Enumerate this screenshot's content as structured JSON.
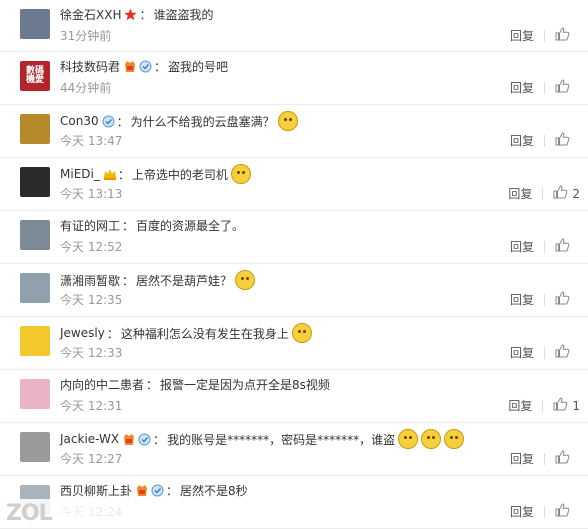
{
  "comments": [
    {
      "username": "徐金石XXH",
      "text": "谁盗盗我的",
      "time": "31分钟前",
      "reply": "回复",
      "likes": "",
      "avatar_color": "#6b7a8f",
      "badges": [
        "star"
      ],
      "emojis": 0,
      "row_h": 52
    },
    {
      "username": "科技数码君",
      "text": "盗我的号吧",
      "time": "44分钟前",
      "reply": "回复",
      "likes": "",
      "avatar_color": "#b3242b",
      "avatar_text": "數碼\n機愛",
      "badges": [
        "vip",
        "medal"
      ],
      "emojis": 0,
      "row_h": 53
    },
    {
      "username": "Con30",
      "text": "为什么不给我的云盘塞满？",
      "time": "今天 13:47",
      "reply": "回复",
      "likes": "",
      "avatar_color": "#b58a2a",
      "badges": [
        "medal"
      ],
      "emojis": 1,
      "row_h": 53
    },
    {
      "username": "MiEDi_",
      "text": "上帝选中的老司机",
      "time": "今天 13:13",
      "reply": "回复",
      "likes": "2",
      "avatar_color": "#2b2b2b",
      "badges": [
        "crown"
      ],
      "emojis": 1,
      "row_h": 53
    },
    {
      "username": "有证的网工",
      "text": "百度的资源最全了。",
      "time": "今天 12:52",
      "reply": "回复",
      "likes": "",
      "avatar_color": "#7c8a96",
      "badges": [],
      "emojis": 0,
      "row_h": 53
    },
    {
      "username": "潇湘雨暂歇",
      "text": "居然不是葫芦娃？",
      "time": "今天 12:35",
      "reply": "回复",
      "likes": "",
      "avatar_color": "#8fa0ae",
      "badges": [],
      "emojis": 1,
      "row_h": 53
    },
    {
      "username": "Jewesly",
      "text": "这种福利怎么没有发生在我身上",
      "time": "今天 12:33",
      "reply": "回复",
      "likes": "",
      "avatar_color": "#f2c82e",
      "badges": [],
      "emojis": 1,
      "row_h": 53
    },
    {
      "username": "内向的中二患者",
      "text": "报警一定是因为点开全是8s视频",
      "time": "今天 12:31",
      "reply": "回复",
      "likes": "1",
      "avatar_color": "#e9b4c3",
      "badges": [],
      "emojis": 0,
      "row_h": 53
    },
    {
      "username": "Jackie-WX",
      "text": "我的账号是*******，密码是*******，谁盗",
      "time": "今天 12:27",
      "reply": "回复",
      "likes": "",
      "avatar_color": "#9a9a9a",
      "badges": [
        "vip",
        "medal"
      ],
      "emojis": 3,
      "row_h": 53
    },
    {
      "username": "西贝柳斯上卦",
      "text": "居然不是8秒",
      "time": "今天 12:24",
      "reply": "回复",
      "likes": "",
      "avatar_color": "#a9b3bc",
      "badges": [
        "vip",
        "medal"
      ],
      "emojis": 0,
      "row_h": 53
    }
  ],
  "colon": "：",
  "watermark": "ZOL"
}
